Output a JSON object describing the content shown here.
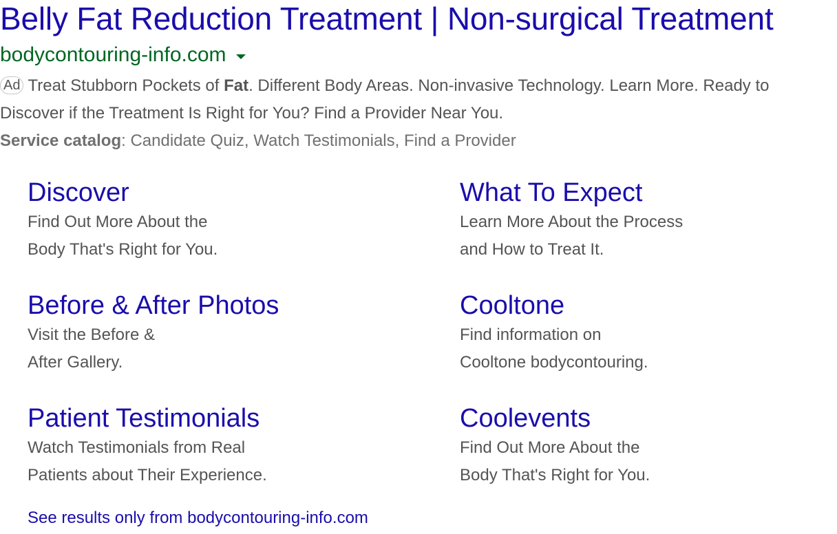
{
  "ad": {
    "title": "Belly Fat Reduction Treatment | Non-surgical Treatment",
    "display_url": "bodycontouring-info.com",
    "dropdown_icon": "caret-down-icon",
    "badge": "Ad",
    "description": {
      "part1": "Treat Stubborn Pockets of ",
      "bold": "Fat",
      "part2": ". Different Body Areas. Non-invasive Technology. Learn More. Ready to Discover if the Treatment Is Right for You? Find a Provider Near You."
    },
    "service_catalog": {
      "label": "Service catalog",
      "separator": ": ",
      "items": "Candidate Quiz, Watch Testimonials, Find a Provider"
    }
  },
  "sitelinks": [
    {
      "title": "Discover",
      "line1": "Find Out More About the",
      "line2": "Body That's Right for You."
    },
    {
      "title": "What To Expect",
      "line1": "Learn More About the Process",
      "line2": "and How to Treat It."
    },
    {
      "title": "Before & After Photos",
      "line1": "Visit the Before &",
      "line2": "After Gallery."
    },
    {
      "title": "Cooltone",
      "line1": "Find information on",
      "line2": "Cooltone bodycontouring."
    },
    {
      "title": "Patient Testimonials",
      "line1": "Watch Testimonials from Real",
      "line2": "Patients about Their Experience."
    },
    {
      "title": "Coolevents",
      "line1": "Find Out More About the",
      "line2": "Body That's Right for You."
    }
  ],
  "see_results": "See results only from bodycontouring-info.com",
  "colors": {
    "link": "#1a0dab",
    "url": "#006621",
    "text": "#545454",
    "muted": "#707070"
  }
}
